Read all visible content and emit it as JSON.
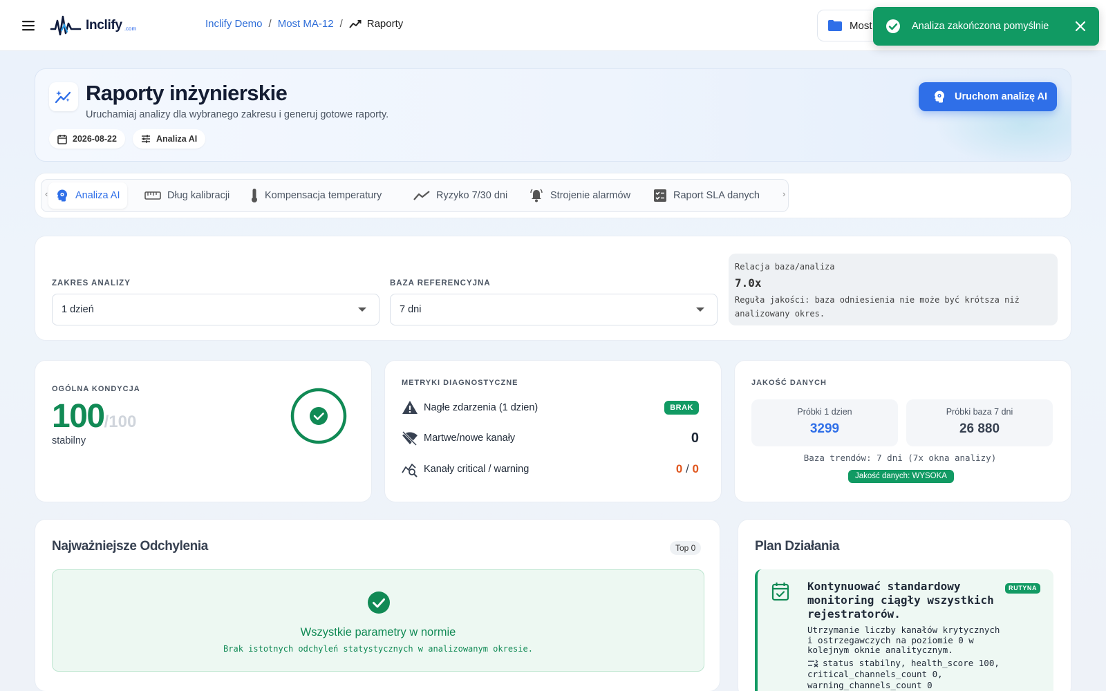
{
  "app": {
    "logo_text": "Inclify",
    "logo_domain": ".com",
    "breadcrumb": [
      "Inclify Demo",
      "Most MA-12"
    ],
    "breadcrumb_current": "Raporty",
    "project_button": "Most"
  },
  "toast": {
    "message": "Analiza zakończona pomyślnie",
    "color": "#119a63"
  },
  "header": {
    "title": "Raporty inżynierskie",
    "subtitle": "Uruchamiaj analizy dla wybranego zakresu i generuj gotowe raporty.",
    "date_chip": "2026-08-22",
    "mode_chip": "Analiza AI",
    "run_button": "Uruchom analizę AI",
    "accent": "#2f6fe8"
  },
  "tabs": [
    {
      "label": "Analiza AI",
      "icon": "ai-brain-icon",
      "active": true
    },
    {
      "label": "Dług kalibracji",
      "icon": "ruler-icon",
      "active": false
    },
    {
      "label": "Kompensacja temperatury",
      "icon": "thermometer-icon",
      "active": false
    },
    {
      "label": "Ryzyko 7/30 dni",
      "icon": "trend-icon",
      "active": false
    },
    {
      "label": "Strojenie alarmów",
      "icon": "bell-icon",
      "active": false
    },
    {
      "label": "Raport SLA danych",
      "icon": "checklist-icon",
      "active": false
    }
  ],
  "range": {
    "scope_label": "ZAKRES ANALIZY",
    "scope_value": "1 dzień",
    "base_label": "BAZA REFERENCYJNA",
    "base_value": "7 dni",
    "relation_label": "Relacja baza/analiza",
    "relation_value": "7.0x",
    "relation_desc": "Reguła jakości: baza odniesienia nie może być krótsza niż analizowany okres."
  },
  "condition": {
    "title": "OGÓLNA KONDYCJA",
    "score": "100",
    "score_max": "/100",
    "status": "stabilny",
    "color": "#118a55"
  },
  "diagnostics": {
    "title": "METRYKI DIAGNOSTYCZNE",
    "sudden_label": "Nagłe zdarzenia (1 dzien)",
    "sudden_badge": "BRAK",
    "dead_label": "Martwe/nowe kanały",
    "dead_value": "0",
    "crit_label": "Kanały critical / warning",
    "crit_value": "0",
    "crit_sep": "/",
    "warn_value": "0",
    "warn_color": "#e0571f"
  },
  "data_quality": {
    "title": "JAKOŚĆ DANYCH",
    "samples_label": "Próbki 1 dzien",
    "samples_value": "3299",
    "base_label": "Próbki baza 7 dni",
    "base_value": "26 880",
    "trend_note": "Baza trendów: 7 dni (7x okna analizy)",
    "quality_pill": "Jakość danych: WYSOKA"
  },
  "deviations": {
    "title": "Najważniejsze Odchylenia",
    "top_pill": "Top 0",
    "ok_title": "Wszystkie parametry w normie",
    "ok_sub": "Brak istotnych odchyleń statystycznych w analizowanym okresie."
  },
  "plan": {
    "title": "Plan Działania",
    "item_title": "Kontynuować standardowy monitoring ciągły wszystkich rejestratorów.",
    "item_badge": "RUTYNA",
    "item_desc": "Utrzymanie liczby kanałów krytycznych i ostrzegawczych na poziomie 0 w kolejnym oknie analitycznym.",
    "item_metric": "status stabilny, health_score 100, critical_channels_count 0, warning_channels_count 0"
  }
}
